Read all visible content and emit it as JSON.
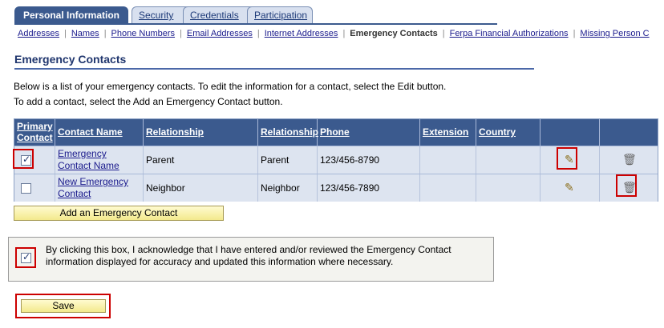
{
  "tabs": [
    {
      "label": "Personal Information",
      "active": true
    },
    {
      "label": "Security",
      "active": false
    },
    {
      "label": "Credentials",
      "active": false
    },
    {
      "label": "Participation",
      "active": false
    }
  ],
  "sublinks": [
    {
      "label": "Addresses"
    },
    {
      "label": "Names"
    },
    {
      "label": "Phone Numbers"
    },
    {
      "label": "Email Addresses"
    },
    {
      "label": "Internet Addresses"
    },
    {
      "label": "Emergency Contacts",
      "current": true
    },
    {
      "label": "Ferpa Financial Authorizations"
    },
    {
      "label": "Missing Person C"
    }
  ],
  "page": {
    "title": "Emergency Contacts",
    "instruction_line1": "Below is a list of your emergency contacts. To edit the information for a contact, select the Edit button.",
    "instruction_line2": "To add a contact, select the Add an Emergency Contact button."
  },
  "grid": {
    "headers": {
      "primary1": "Primary",
      "primary2": "Contact",
      "name": "Contact Name",
      "relationship": "Relationship",
      "relationship2": "Relationship",
      "phone": "Phone",
      "extension": "Extension",
      "country": "Country"
    },
    "rows": [
      {
        "primary": true,
        "name_line1": "Emergency",
        "name_line2": "Contact Name",
        "relationship": "Parent",
        "relationship2": "Parent",
        "phone": "123/456-8790",
        "extension": "",
        "country": ""
      },
      {
        "primary": false,
        "name_line1": "New Emergency",
        "name_line2": "Contact",
        "relationship": "Neighbor",
        "relationship2": "Neighbor",
        "phone": "123/456-7890",
        "extension": "",
        "country": ""
      }
    ]
  },
  "buttons": {
    "add": "Add an Emergency Contact",
    "save": "Save"
  },
  "ack": {
    "checked": true,
    "line1": "By clicking this box, I acknowledge that I have entered and/or reviewed the Emergency Contact",
    "line2": "information displayed for accuracy and updated this information where necessary."
  },
  "icons": {
    "edit": "pencil-icon",
    "delete": "trash-icon"
  },
  "colors": {
    "header_bg": "#3b5a8e",
    "row_bg": "#dde4f0",
    "highlight": "#cc0000",
    "button_bg": "#f7f1a8"
  }
}
